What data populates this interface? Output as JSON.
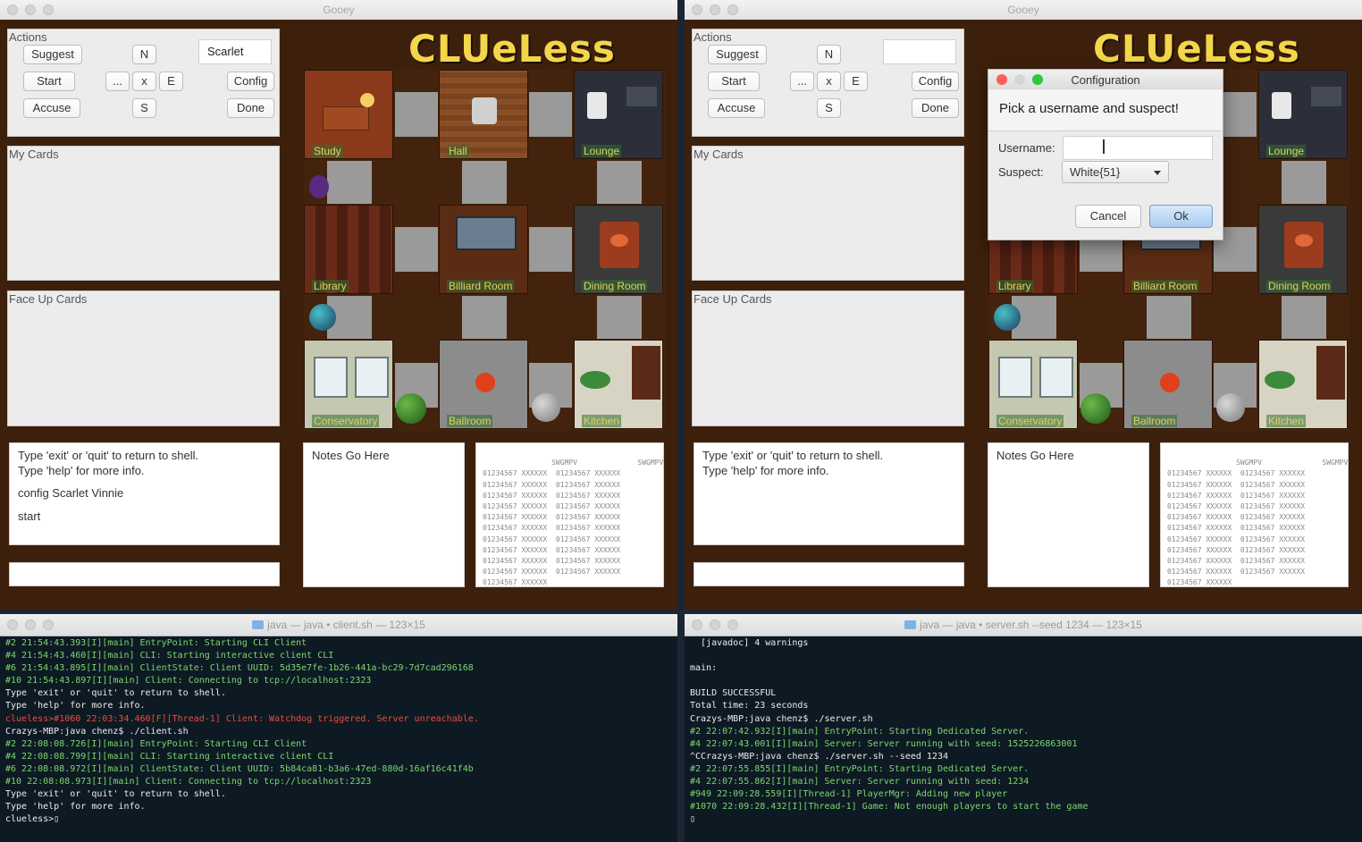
{
  "left": {
    "window_title": "Gooey",
    "actions_label": "Actions",
    "buttons": {
      "suggest": "Suggest",
      "start": "Start",
      "accuse": "Accuse",
      "config": "Config",
      "done": "Done"
    },
    "directions": {
      "n": "N",
      "s": "S",
      "e": "E",
      "x": "x",
      "dots": "..."
    },
    "name_field": "Scarlet",
    "logo": "CLUeLess",
    "my_cards": "My Cards",
    "face_up": "Face Up Cards",
    "console_lines": [
      "Type 'exit' or 'quit' to return to shell.",
      "Type 'help' for more info.",
      "config Scarlet Vinnie",
      "start"
    ],
    "notes": "Notes Go Here"
  },
  "right": {
    "window_title": "Gooey",
    "actions_label": "Actions",
    "buttons": {
      "suggest": "Suggest",
      "start": "Start",
      "accuse": "Accuse",
      "config": "Config",
      "done": "Done"
    },
    "directions": {
      "n": "N",
      "s": "S",
      "e": "E",
      "x": "x",
      "dots": "..."
    },
    "name_field": "",
    "logo": "CLUeLess",
    "my_cards": "My Cards",
    "face_up": "Face Up Cards",
    "console_lines": [
      "Type 'exit' or 'quit' to return to shell.",
      "Type 'help' for more info."
    ],
    "notes": "Notes Go Here"
  },
  "rooms": {
    "study": "Study",
    "hall": "Hall",
    "lounge": "Lounge",
    "library": "Library",
    "billiard": "Billiard Room",
    "dining": "Dining Room",
    "conservatory": "Conservatory",
    "ballroom": "Ballroom",
    "kitchen": "Kitchen"
  },
  "grid": {
    "header": "                SWGMPV              SWGMPV",
    "row": "01234567 XXXXXX  01234567 XXXXXX",
    "last_row": "01234567 XXXXXX"
  },
  "dialog": {
    "title": "Configuration",
    "header": "Pick a username and suspect!",
    "username_label": "Username:",
    "username_value": "",
    "suspect_label": "Suspect:",
    "suspect_value": "White{51}",
    "cancel": "Cancel",
    "ok": "Ok"
  },
  "terminal_left": {
    "title": "java — java • client.sh — 123×15",
    "lines": [
      {
        "c": "g",
        "t": "#2 21:54:43.393[I][main] EntryPoint: Starting CLI Client"
      },
      {
        "c": "g",
        "t": "#4 21:54:43.460[I][main] CLI: Starting interactive client CLI"
      },
      {
        "c": "g",
        "t": "#6 21:54:43.895[I][main] ClientState: Client UUID: 5d35e7fe-1b26-441a-bc29-7d7cad296168"
      },
      {
        "c": "g",
        "t": "#10 21:54:43.897[I][main] Client: Connecting to tcp://localhost:2323"
      },
      {
        "c": "w",
        "t": "Type 'exit' or 'quit' to return to shell."
      },
      {
        "c": "w",
        "t": "Type 'help' for more info."
      },
      {
        "c": "r",
        "t": "clueless>#1060 22:03:34.460[F][Thread-1] Client: Watchdog triggered. Server unreachable."
      },
      {
        "c": "w",
        "t": "Crazys-MBP:java chenz$ ./client.sh"
      },
      {
        "c": "g",
        "t": "#2 22:08:08.726[I][main] EntryPoint: Starting CLI Client"
      },
      {
        "c": "g",
        "t": "#4 22:08:08.799[I][main] CLI: Starting interactive client CLI"
      },
      {
        "c": "g",
        "t": "#6 22:08:08.972[I][main] ClientState: Client UUID: 5b84ca81-b3a6-47ed-880d-16af16c41f4b"
      },
      {
        "c": "g",
        "t": "#10 22:08:08.973[I][main] Client: Connecting to tcp://localhost:2323"
      },
      {
        "c": "w",
        "t": "Type 'exit' or 'quit' to return to shell."
      },
      {
        "c": "w",
        "t": "Type 'help' for more info."
      },
      {
        "c": "w",
        "t": "clueless>▯"
      }
    ]
  },
  "terminal_right": {
    "title": "java — java • server.sh --seed 1234 — 123×15",
    "lines": [
      {
        "c": "w",
        "t": "  [javadoc] 4 warnings"
      },
      {
        "c": "w",
        "t": ""
      },
      {
        "c": "w",
        "t": "main:"
      },
      {
        "c": "w",
        "t": ""
      },
      {
        "c": "w",
        "t": "BUILD SUCCESSFUL"
      },
      {
        "c": "w",
        "t": "Total time: 23 seconds"
      },
      {
        "c": "w",
        "t": "Crazys-MBP:java chenz$ ./server.sh"
      },
      {
        "c": "g",
        "t": "#2 22:07:42.932[I][main] EntryPoint: Starting Dedicated Server."
      },
      {
        "c": "g",
        "t": "#4 22:07:43.001[I][main] Server: Server running with seed: 1525226863001"
      },
      {
        "c": "w",
        "t": "^CCrazys-MBP:java chenz$ ./server.sh --seed 1234"
      },
      {
        "c": "g",
        "t": "#2 22:07:55.855[I][main] EntryPoint: Starting Dedicated Server."
      },
      {
        "c": "g",
        "t": "#4 22:07:55.862[I][main] Server: Server running with seed: 1234"
      },
      {
        "c": "g",
        "t": "#949 22:09:28.559[I][Thread-1] PlayerMgr: Adding new player"
      },
      {
        "c": "g",
        "t": "#1070 22:09:28.432[I][Thread-1] Game: Not enough players to start the game"
      },
      {
        "c": "w",
        "t": "▯"
      }
    ]
  }
}
